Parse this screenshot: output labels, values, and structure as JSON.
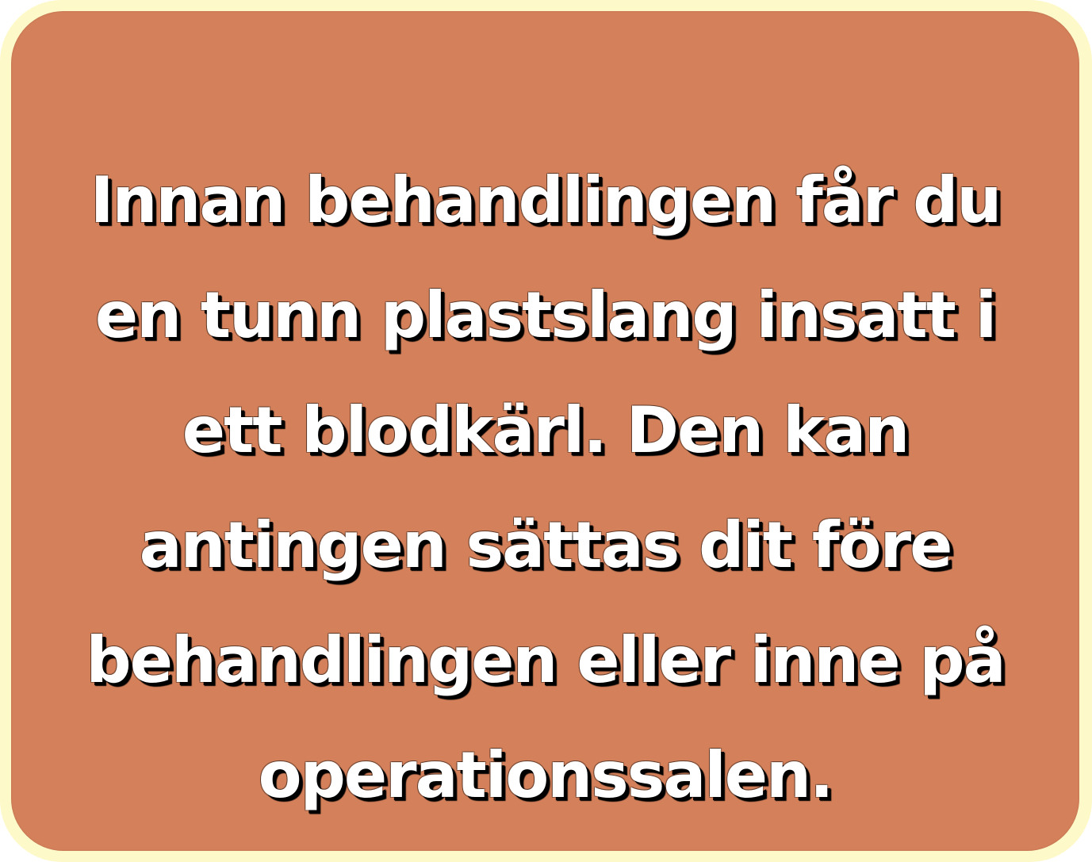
{
  "card": {
    "background_color": "#d4805a",
    "border_color": "#fdf9c9",
    "text_color": "#ffffff",
    "text_shadow_color": "#000000",
    "lines": [
      "Innan behandlingen får du",
      "en tunn plastslang insatt i",
      "ett blodkärl. Den kan",
      "antingen sättas dit före",
      "behandlingen eller inne på",
      "operationssalen."
    ]
  }
}
